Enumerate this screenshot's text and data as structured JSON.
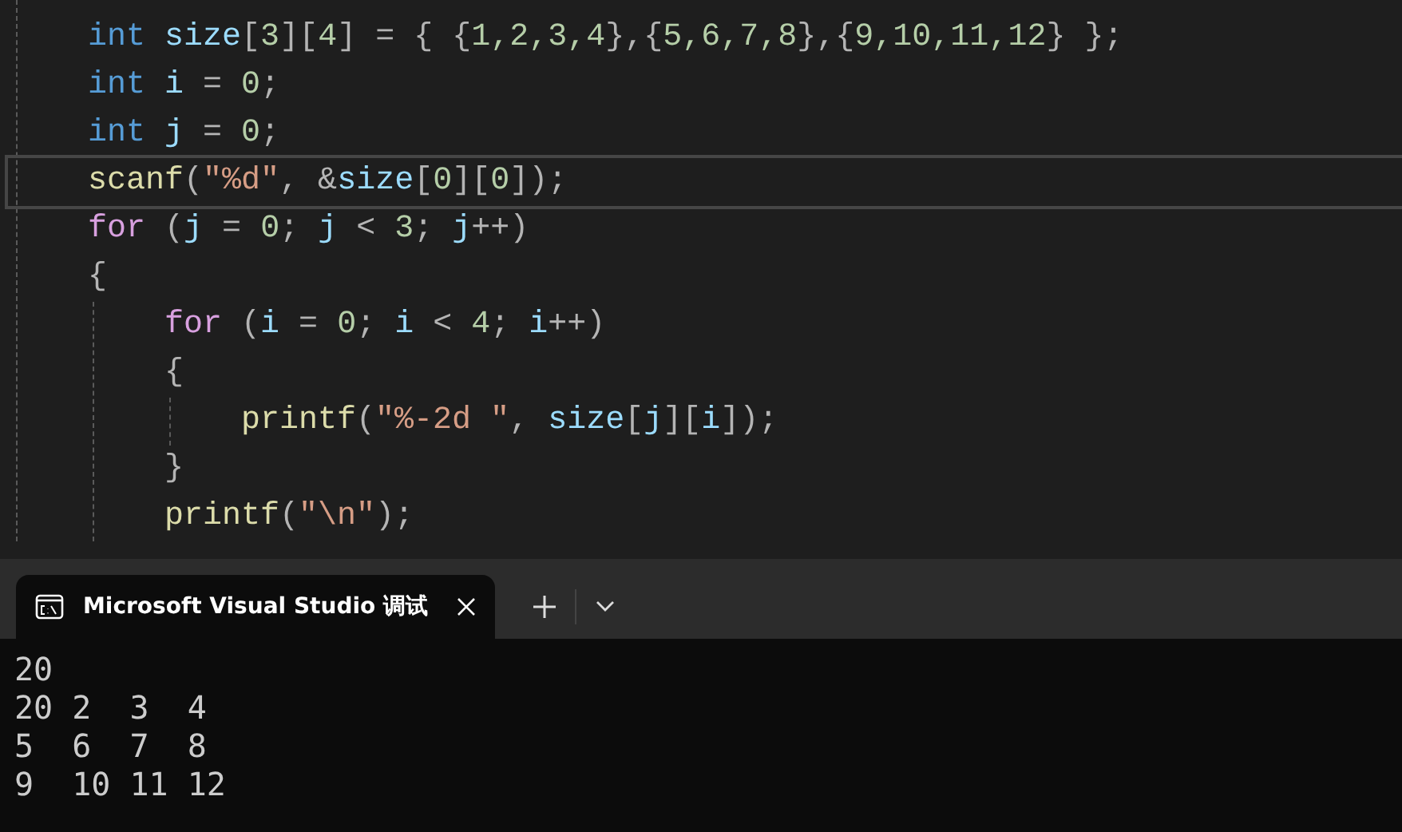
{
  "editor": {
    "lines": [
      {
        "current": false,
        "tokens": [
          {
            "kind": "keyword",
            "text": "int"
          },
          {
            "kind": "ident",
            "text": " size"
          },
          {
            "kind": "punct",
            "text": "["
          },
          {
            "kind": "number",
            "text": "3"
          },
          {
            "kind": "punct",
            "text": "]["
          },
          {
            "kind": "number",
            "text": "4"
          },
          {
            "kind": "punct",
            "text": "] = { {"
          },
          {
            "kind": "number",
            "text": "1,2,3,4"
          },
          {
            "kind": "punct",
            "text": "},{"
          },
          {
            "kind": "number",
            "text": "5,6,7,8"
          },
          {
            "kind": "punct",
            "text": "},{"
          },
          {
            "kind": "number",
            "text": "9,10,11,12"
          },
          {
            "kind": "punct",
            "text": "} };"
          }
        ]
      },
      {
        "current": false,
        "tokens": [
          {
            "kind": "keyword",
            "text": "int"
          },
          {
            "kind": "ident",
            "text": " i"
          },
          {
            "kind": "punct",
            "text": " = "
          },
          {
            "kind": "number",
            "text": "0"
          },
          {
            "kind": "punct",
            "text": ";"
          }
        ]
      },
      {
        "current": false,
        "tokens": [
          {
            "kind": "keyword",
            "text": "int"
          },
          {
            "kind": "ident",
            "text": " j"
          },
          {
            "kind": "punct",
            "text": " = "
          },
          {
            "kind": "number",
            "text": "0"
          },
          {
            "kind": "punct",
            "text": ";"
          }
        ]
      },
      {
        "current": true,
        "tokens": [
          {
            "kind": "func",
            "text": "scanf"
          },
          {
            "kind": "punct",
            "text": "("
          },
          {
            "kind": "string",
            "text": "\"%d\""
          },
          {
            "kind": "punct",
            "text": ", &"
          },
          {
            "kind": "ident",
            "text": "size"
          },
          {
            "kind": "punct",
            "text": "["
          },
          {
            "kind": "number",
            "text": "0"
          },
          {
            "kind": "punct",
            "text": "]["
          },
          {
            "kind": "number",
            "text": "0"
          },
          {
            "kind": "punct",
            "text": "]);"
          }
        ]
      },
      {
        "current": false,
        "tokens": [
          {
            "kind": "control",
            "text": "for"
          },
          {
            "kind": "punct",
            "text": " ("
          },
          {
            "kind": "ident",
            "text": "j"
          },
          {
            "kind": "punct",
            "text": " = "
          },
          {
            "kind": "number",
            "text": "0"
          },
          {
            "kind": "punct",
            "text": "; "
          },
          {
            "kind": "ident",
            "text": "j"
          },
          {
            "kind": "punct",
            "text": " < "
          },
          {
            "kind": "number",
            "text": "3"
          },
          {
            "kind": "punct",
            "text": "; "
          },
          {
            "kind": "ident",
            "text": "j"
          },
          {
            "kind": "punct",
            "text": "++)"
          }
        ]
      },
      {
        "current": false,
        "tokens": [
          {
            "kind": "punct",
            "text": "{"
          }
        ],
        "children": [
          {
            "current": false,
            "tokens": [
              {
                "kind": "control",
                "text": "for"
              },
              {
                "kind": "punct",
                "text": " ("
              },
              {
                "kind": "ident",
                "text": "i"
              },
              {
                "kind": "punct",
                "text": " = "
              },
              {
                "kind": "number",
                "text": "0"
              },
              {
                "kind": "punct",
                "text": "; "
              },
              {
                "kind": "ident",
                "text": "i"
              },
              {
                "kind": "punct",
                "text": " < "
              },
              {
                "kind": "number",
                "text": "4"
              },
              {
                "kind": "punct",
                "text": "; "
              },
              {
                "kind": "ident",
                "text": "i"
              },
              {
                "kind": "punct",
                "text": "++)"
              }
            ]
          },
          {
            "current": false,
            "tokens": [
              {
                "kind": "punct",
                "text": "{"
              }
            ],
            "children": [
              {
                "current": false,
                "tokens": [
                  {
                    "kind": "func",
                    "text": "printf"
                  },
                  {
                    "kind": "punct",
                    "text": "("
                  },
                  {
                    "kind": "string",
                    "text": "\"%-2d \""
                  },
                  {
                    "kind": "punct",
                    "text": ", "
                  },
                  {
                    "kind": "ident",
                    "text": "size"
                  },
                  {
                    "kind": "punct",
                    "text": "["
                  },
                  {
                    "kind": "ident",
                    "text": "j"
                  },
                  {
                    "kind": "punct",
                    "text": "]["
                  },
                  {
                    "kind": "ident",
                    "text": "i"
                  },
                  {
                    "kind": "punct",
                    "text": "]);"
                  }
                ]
              }
            ]
          },
          {
            "current": false,
            "tokens": [
              {
                "kind": "punct",
                "text": "}"
              }
            ]
          },
          {
            "current": false,
            "tokens": [
              {
                "kind": "func",
                "text": "printf"
              },
              {
                "kind": "punct",
                "text": "("
              },
              {
                "kind": "string",
                "text": "\"\\n\""
              },
              {
                "kind": "punct",
                "text": ");"
              }
            ]
          }
        ]
      }
    ]
  },
  "terminal": {
    "tabs": [
      {
        "title": "Microsoft Visual Studio 调试",
        "selected": true
      }
    ],
    "output": [
      "20",
      "20 2  3  4",
      "5  6  7  8",
      "9  10 11 12"
    ]
  }
}
